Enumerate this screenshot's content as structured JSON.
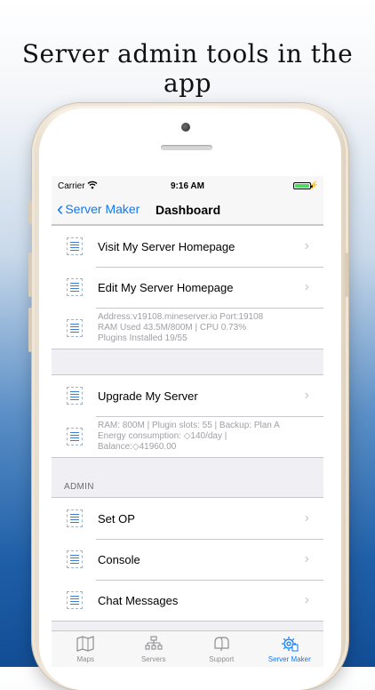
{
  "headline": "Server admin tools in the app",
  "status": {
    "carrier": "Carrier",
    "time": "9:16 AM"
  },
  "nav": {
    "back_label": "Server Maker",
    "title": "Dashboard"
  },
  "section1": {
    "rows": [
      {
        "label": "Visit My Server Homepage"
      },
      {
        "label": "Edit My Server Homepage"
      },
      {
        "info_lines": [
          "Address:v19108.mineserver.io Port:19108",
          "RAM Used 43.5M/800M | CPU 0.73%",
          "Plugins Installed 19/55"
        ]
      }
    ]
  },
  "section2": {
    "rows": [
      {
        "label": "Upgrade My Server"
      },
      {
        "info_lines": [
          "RAM: 800M | Plugin slots: 55 | Backup: Plan A",
          "Energy consumption: ◇140/day |",
          "Balance:◇41960.00"
        ]
      }
    ]
  },
  "admin": {
    "header": "ADMIN",
    "rows": [
      {
        "label": "Set OP"
      },
      {
        "label": "Console"
      },
      {
        "label": "Chat Messages"
      }
    ]
  },
  "tabs": [
    {
      "label": "Maps",
      "icon": "map-icon",
      "active": false
    },
    {
      "label": "Servers",
      "icon": "servers-icon",
      "active": false
    },
    {
      "label": "Support",
      "icon": "mailbox-icon",
      "active": false
    },
    {
      "label": "Server Maker",
      "icon": "gear-icon",
      "active": true
    }
  ],
  "colors": {
    "accent": "#0a7aff",
    "battery": "#4cd964"
  }
}
